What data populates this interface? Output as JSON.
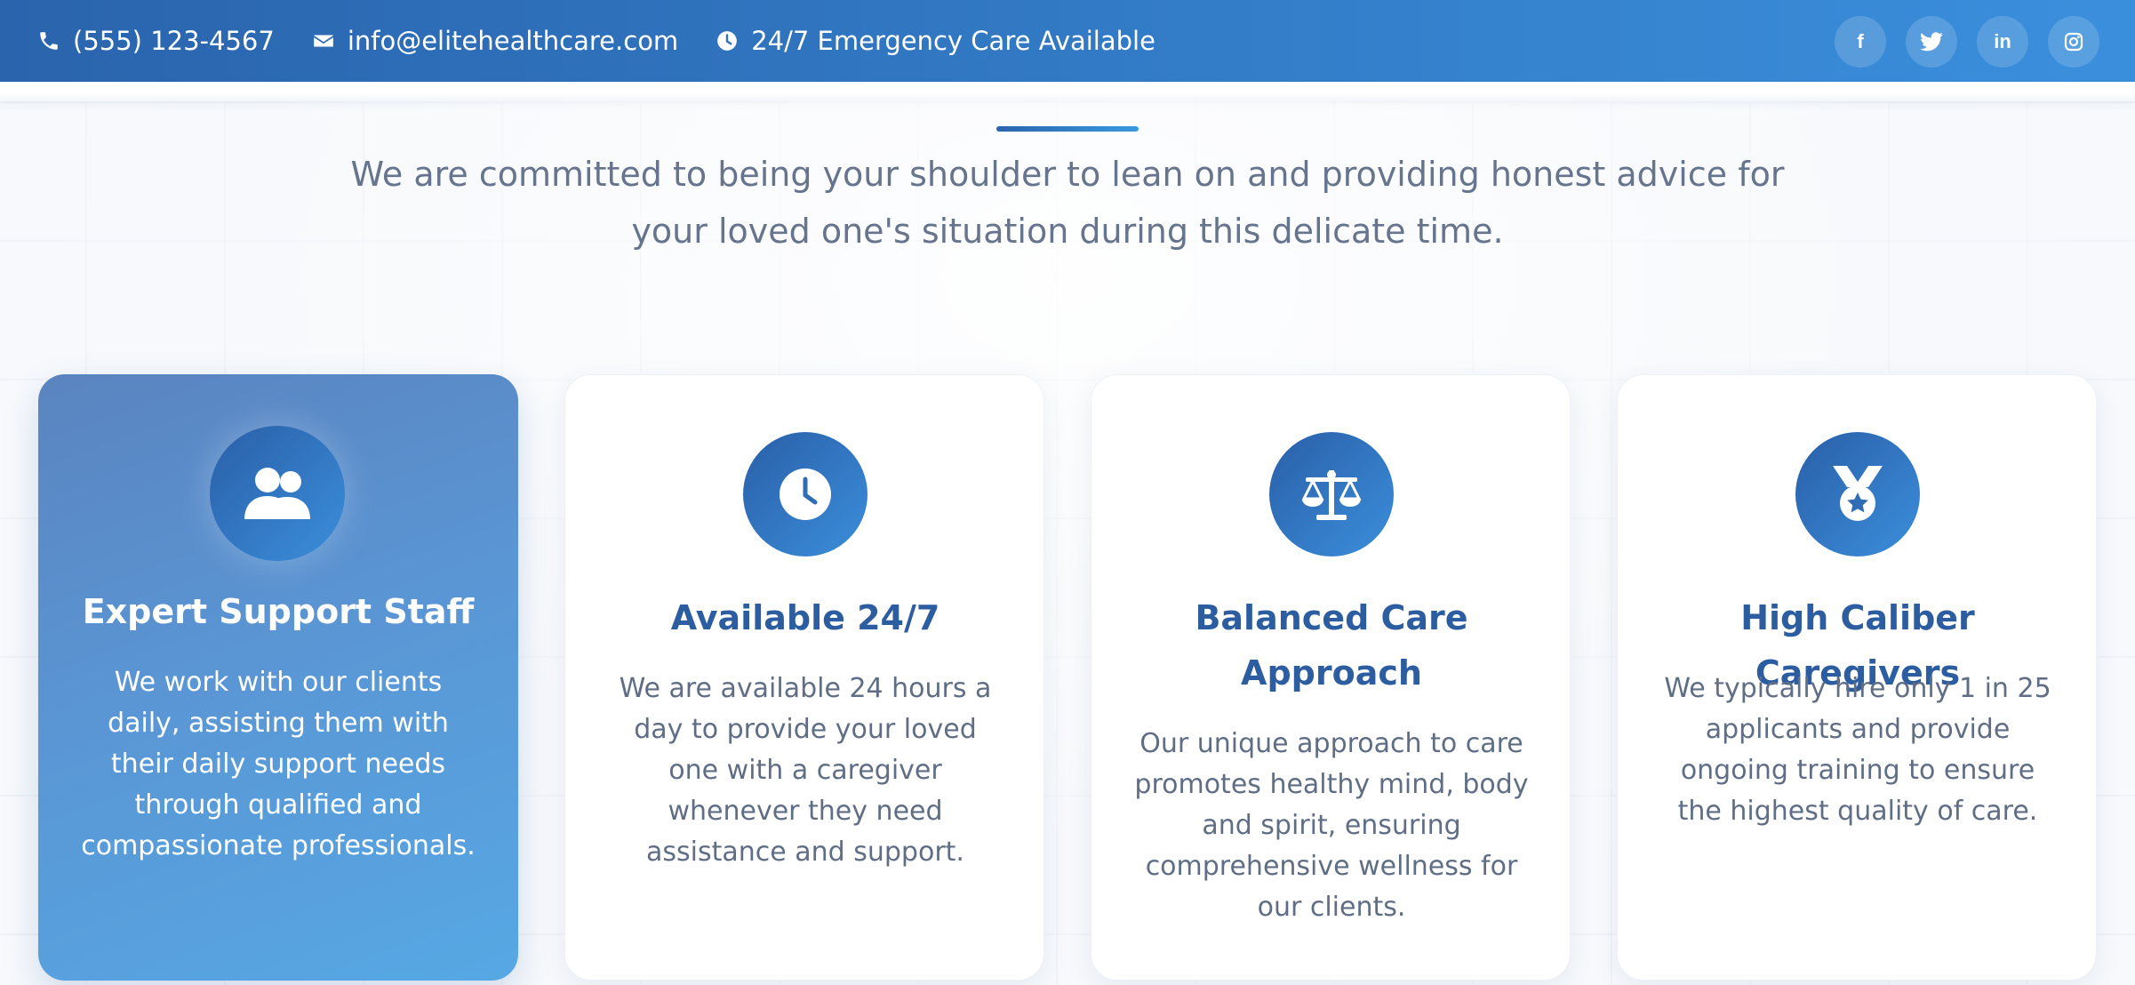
{
  "topbar": {
    "phone": "(555) 123-4567",
    "email": "info@elitehealthcare.com",
    "emergency": "24/7 Emergency Care Available",
    "socials": [
      {
        "icon": "facebook-icon",
        "glyph": "f"
      },
      {
        "icon": "twitter-icon",
        "glyph": "t"
      },
      {
        "icon": "linkedin-icon",
        "glyph": "in"
      },
      {
        "icon": "instagram-icon",
        "glyph": "ig"
      }
    ]
  },
  "intro": {
    "text": "We are committed to being your shoulder to lean on and providing honest advice for your loved one's situation during this delicate time."
  },
  "features": [
    {
      "icon": "users-icon",
      "title": "Expert Support Staff",
      "description": "We work with our clients daily, assisting them with their daily support needs through qualified and compassionate professionals."
    },
    {
      "icon": "clock-icon",
      "title": "Available 24/7",
      "description": "We are available 24 hours a day to provide your loved one with a caregiver whenever they need assistance and support."
    },
    {
      "icon": "balance-scale-icon",
      "title": "Balanced Care Approach",
      "description": "Our unique approach to care promotes healthy mind, body and spirit, ensuring comprehensive wellness for our clients."
    },
    {
      "icon": "medal-icon",
      "title": "High Caliber Caregivers",
      "description": "We typically hire only 1 in 25 applicants and provide ongoing training to ensure the highest quality of care."
    }
  ],
  "colors": {
    "brand_primary": "#2a64ad",
    "brand_secondary": "#3a8fdc",
    "title_blue": "#2d5da1",
    "body_text": "#5f6e85"
  }
}
